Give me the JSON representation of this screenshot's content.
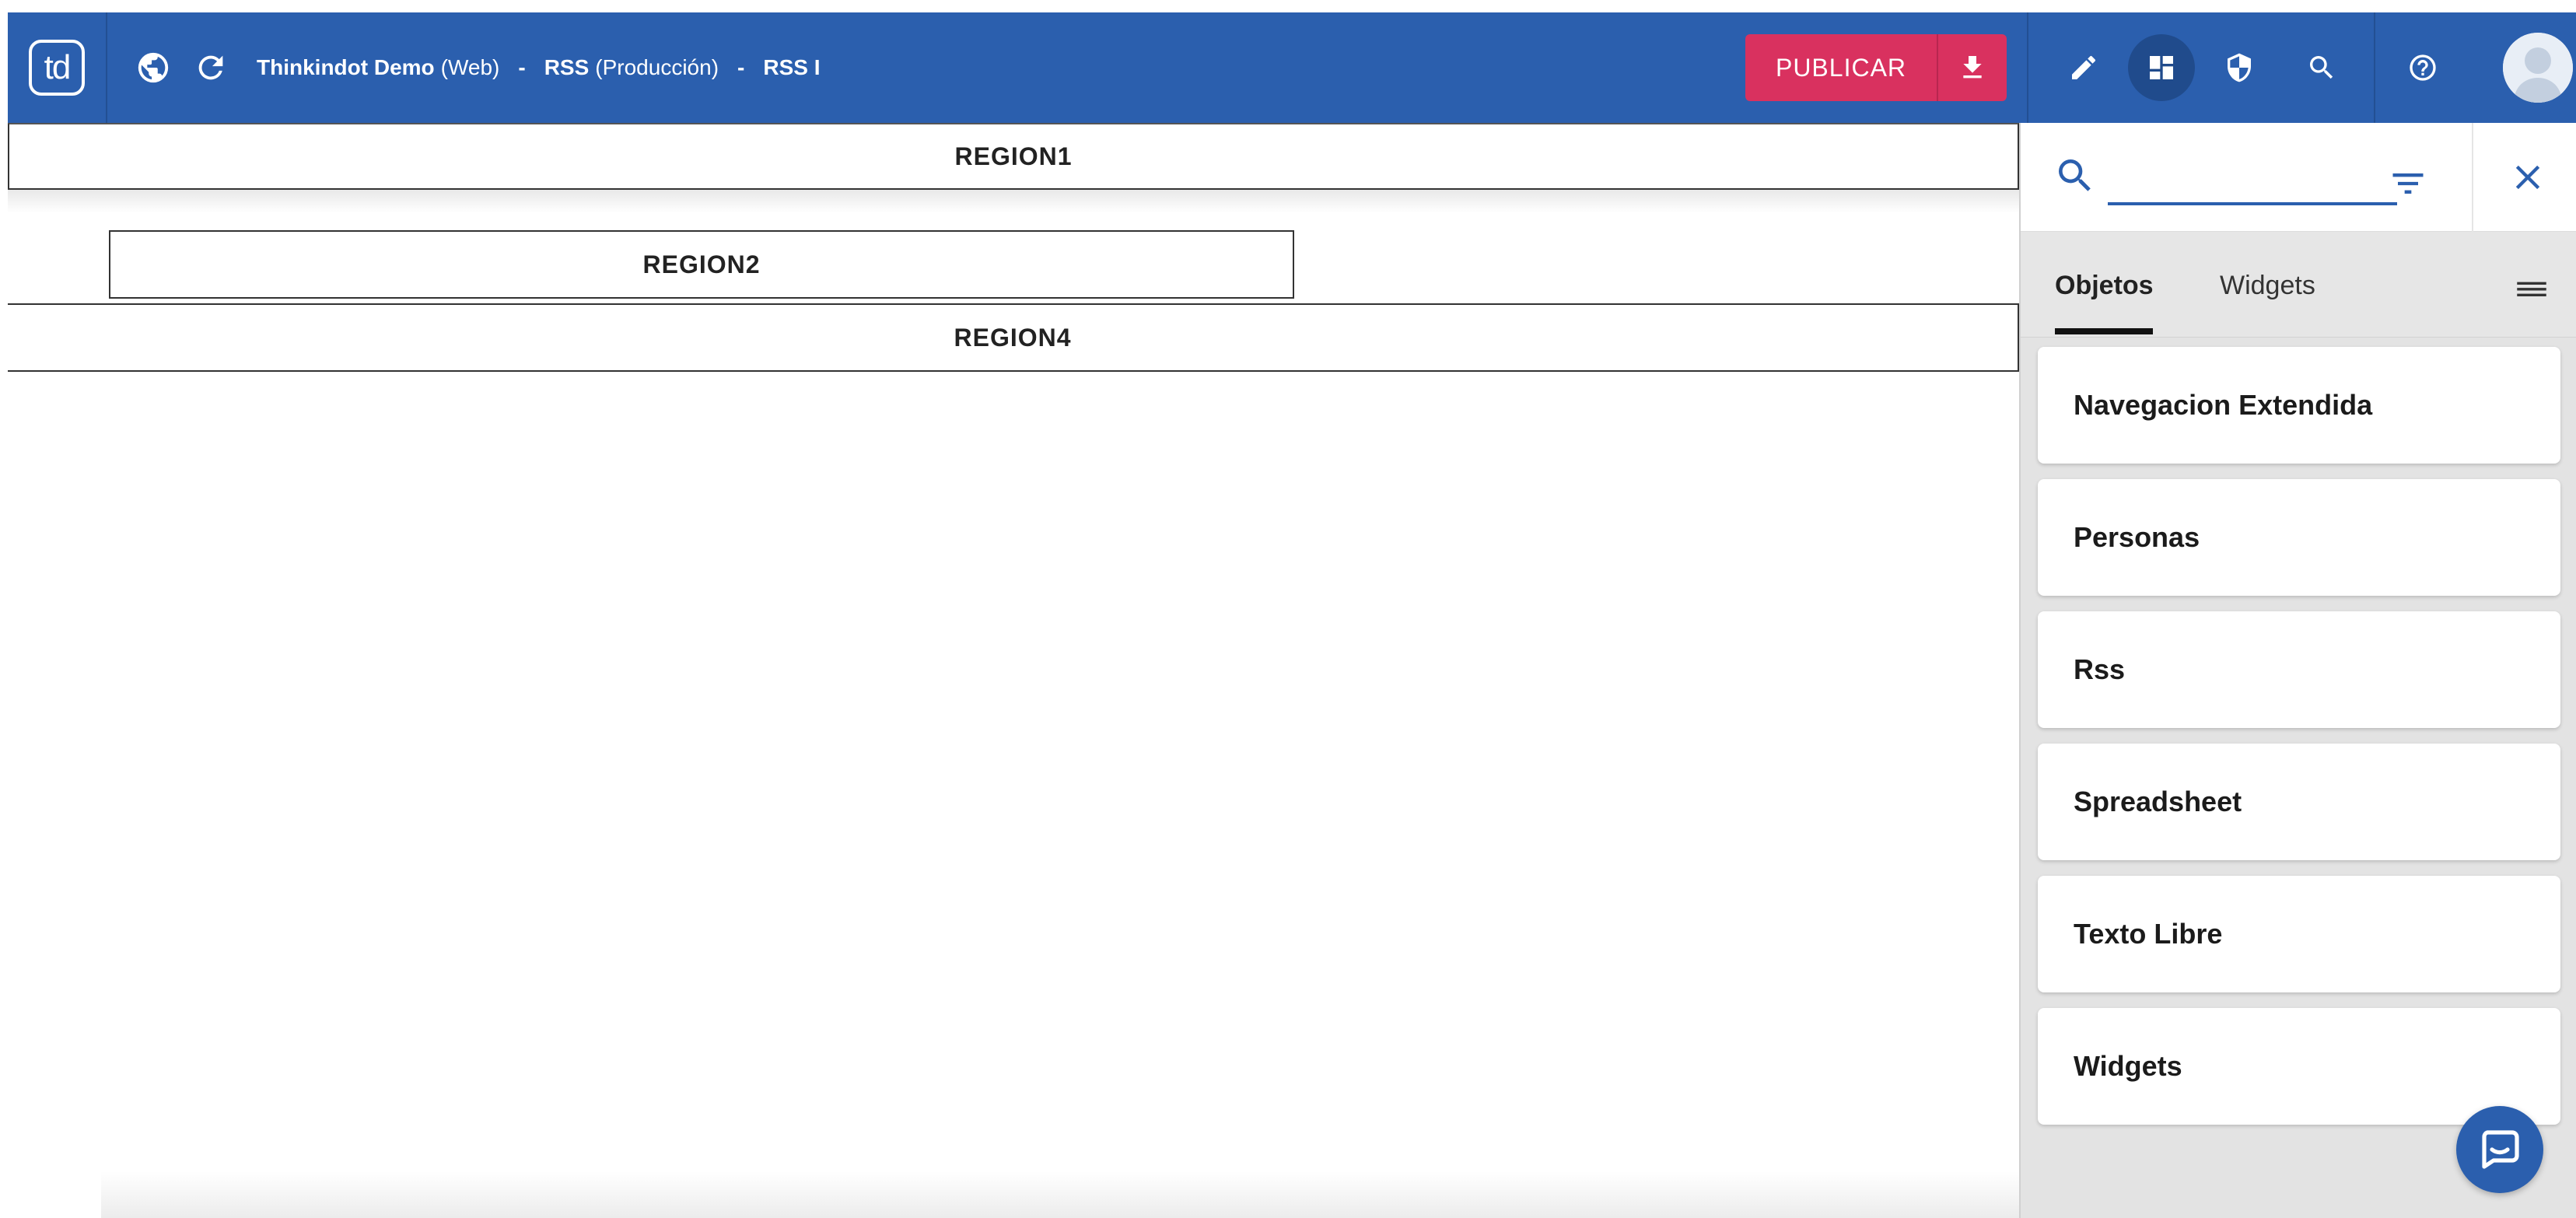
{
  "header": {
    "logo_text": "td",
    "breadcrumb": {
      "site_name": "Thinkindot Demo",
      "site_type": "(Web)",
      "sep1": "-",
      "section_name": "RSS",
      "section_env": "(Producción)",
      "sep2": "-",
      "page_name": "RSS I"
    },
    "publish_label": "PUBLICAR",
    "accent_color": "#2b5fae",
    "publish_color": "#d9315f"
  },
  "canvas": {
    "regions": [
      "REGION1",
      "REGION2",
      "REGION4"
    ]
  },
  "panel": {
    "search_placeholder": "",
    "tabs": [
      {
        "label": "Objetos",
        "active": true
      },
      {
        "label": "Widgets",
        "active": false
      }
    ],
    "items": [
      "Navegacion Extendida",
      "Personas",
      "Rss",
      "Spreadsheet",
      "Texto Libre",
      "Widgets"
    ]
  }
}
